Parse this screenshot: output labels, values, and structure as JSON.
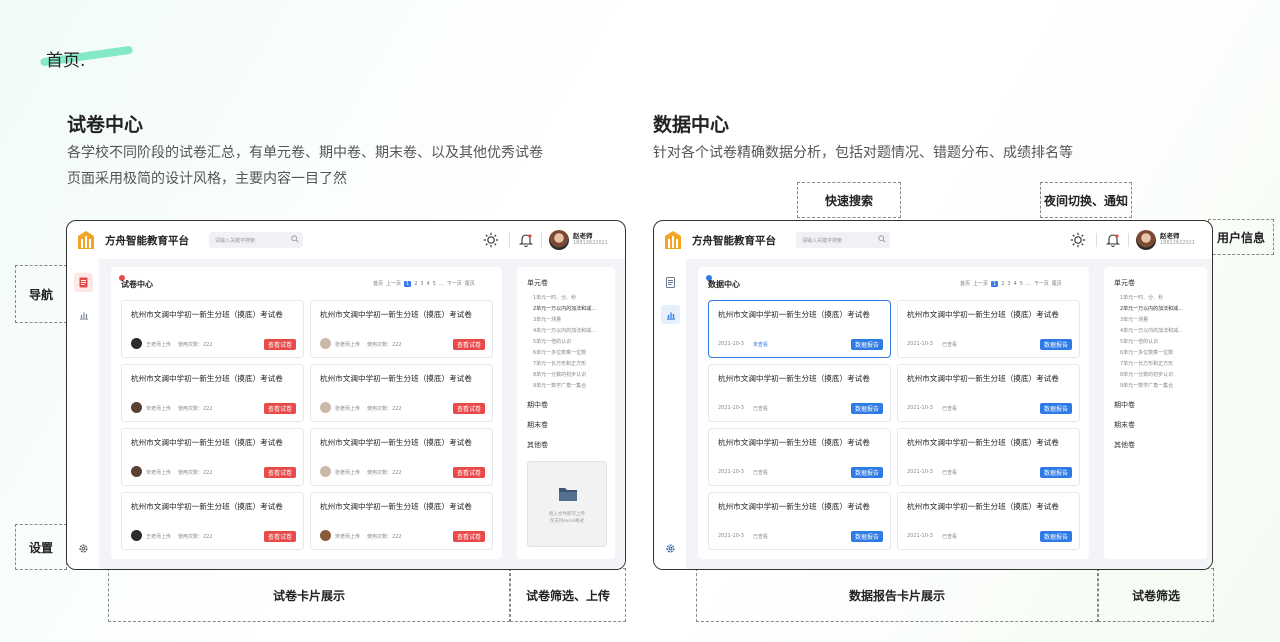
{
  "page_title": "首页.",
  "left": {
    "heading": "试卷中心",
    "desc1": "各学校不同阶段的试卷汇总，有单元卷、期中卷、期末卷、以及其他优秀试卷",
    "desc2": "页面采用极简的设计风格，主要内容一目了然",
    "tags": {
      "nav": "导航",
      "settings": "设置",
      "cards": "试卷卡片展示",
      "filter": "试卷筛选、上传"
    },
    "panel_title": "试卷中心",
    "cards": [
      {
        "title": "杭州市文澜中学初一新生分班（摸底）考试卷",
        "uploader": "王老师上传",
        "uses": "使用次数：222",
        "btn": "查看试卷"
      },
      {
        "title": "杭州市文澜中学初一新生分班（摸底）考试卷",
        "uploader": "张老师上传",
        "uses": "使用次数：222",
        "btn": "查看试卷"
      },
      {
        "title": "杭州市文澜中学初一新生分班（摸底）考试卷",
        "uploader": "宋老师上传",
        "uses": "使用次数：222",
        "btn": "查看试卷"
      },
      {
        "title": "杭州市文澜中学初一新生分班（摸底）考试卷",
        "uploader": "张老师上传",
        "uses": "使用次数：222",
        "btn": "查看试卷"
      },
      {
        "title": "杭州市文澜中学初一新生分班（摸底）考试卷",
        "uploader": "宋老师上传",
        "uses": "使用次数：222",
        "btn": "查看试卷"
      },
      {
        "title": "杭州市文澜中学初一新生分班（摸底）考试卷",
        "uploader": "张老师上传",
        "uses": "使用次数：222",
        "btn": "查看试卷"
      },
      {
        "title": "杭州市文澜中学初一新生分班（摸底）考试卷",
        "uploader": "王老师上传",
        "uses": "使用次数：222",
        "btn": "查看试卷"
      },
      {
        "title": "杭州市文澜中学初一新生分班（摸底）考试卷",
        "uploader": "宋老师上传",
        "uses": "使用次数：222",
        "btn": "查看试卷"
      }
    ],
    "upload_text1": "拖入文件即可上传",
    "upload_text2": "仅支持excel格式"
  },
  "right": {
    "heading": "数据中心",
    "desc1": "针对各个试卷精确数据分析，包括对题情况、错题分布、成绩排名等",
    "tags": {
      "search": "快速搜索",
      "night": "夜间切换、通知",
      "user": "用户信息",
      "cards": "数据报告卡片展示",
      "filter": "试卷筛选"
    },
    "panel_title": "数据中心",
    "cards": [
      {
        "title": "杭州市文澜中学初一新生分班（摸底）考试卷",
        "date": "2021-10-3",
        "status": "未查看",
        "btn": "数据报告"
      },
      {
        "title": "杭州市文澜中学初一新生分班（摸底）考试卷",
        "date": "2021-10-3",
        "status": "已查看",
        "btn": "数据报告"
      },
      {
        "title": "杭州市文澜中学初一新生分班（摸底）考试卷",
        "date": "2021-10-3",
        "status": "已查看",
        "btn": "数据报告"
      },
      {
        "title": "杭州市文澜中学初一新生分班（摸底）考试卷",
        "date": "2021-10-3",
        "status": "已查看",
        "btn": "数据报告"
      },
      {
        "title": "杭州市文澜中学初一新生分班（摸底）考试卷",
        "date": "2021-10-3",
        "status": "已查看",
        "btn": "数据报告"
      },
      {
        "title": "杭州市文澜中学初一新生分班（摸底）考试卷",
        "date": "2021-10-3",
        "status": "已查看",
        "btn": "数据报告"
      },
      {
        "title": "杭州市文澜中学初一新生分班（摸底）考试卷",
        "date": "2021-10-3",
        "status": "已查看",
        "btn": "数据报告"
      },
      {
        "title": "杭州市文澜中学初一新生分班（摸底）考试卷",
        "date": "2021-10-3",
        "status": "已查看",
        "btn": "数据报告"
      }
    ]
  },
  "app": {
    "brand": "方舟智能教育平台",
    "search_placeholder": "请输入关键字搜索",
    "user_name": "赵老师",
    "user_phone": "18812622021",
    "pager": [
      "首页",
      "上一页",
      "1",
      "2",
      "3",
      "4",
      "5",
      "...",
      "下一页",
      "尾页"
    ]
  },
  "filter": {
    "unit": "单元卷",
    "items": [
      "1单元一时、分、秒",
      "2单元一万以内的加法和减…",
      "3单元一测量",
      "4单元一万以内的加法和减…",
      "5单元一倍的认识",
      "6单元一多位数乘一位数",
      "7单元一长方形和正方形",
      "8单元一分数的初步认识",
      "9单元一数学广角一集合"
    ],
    "mid": "期中卷",
    "final": "期末卷",
    "other": "其他卷"
  },
  "colors": {
    "red": "#e84a4a",
    "blue": "#2f7be6",
    "accent_green": "#5fe3b6"
  }
}
